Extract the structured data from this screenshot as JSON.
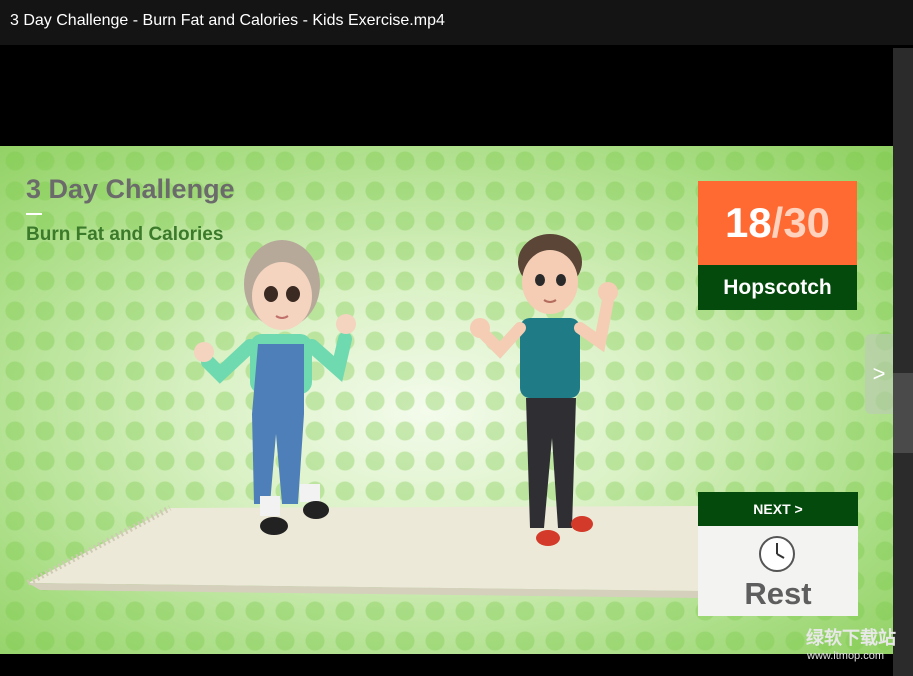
{
  "window": {
    "title": "3 Day Challenge - Burn Fat and Calories - Kids Exercise.mp4"
  },
  "video": {
    "title": "3 Day Challenge",
    "subtitle": "Burn Fat and Calories",
    "counter_current": "18",
    "counter_total": "/30",
    "exercise_name": "Hopscotch",
    "next_label": "NEXT >",
    "next_exercise": "Rest"
  },
  "nav": {
    "next_arrow": ">"
  },
  "watermark": {
    "text": "绿软下载站",
    "url": "www.ltmop.com"
  },
  "colors": {
    "counter_bg": "#ff6a33",
    "label_bg": "#044a0c",
    "bg_green": "#a9dd84"
  },
  "icons": {
    "clock": "clock-icon",
    "arrow": "chevron-right-icon"
  }
}
